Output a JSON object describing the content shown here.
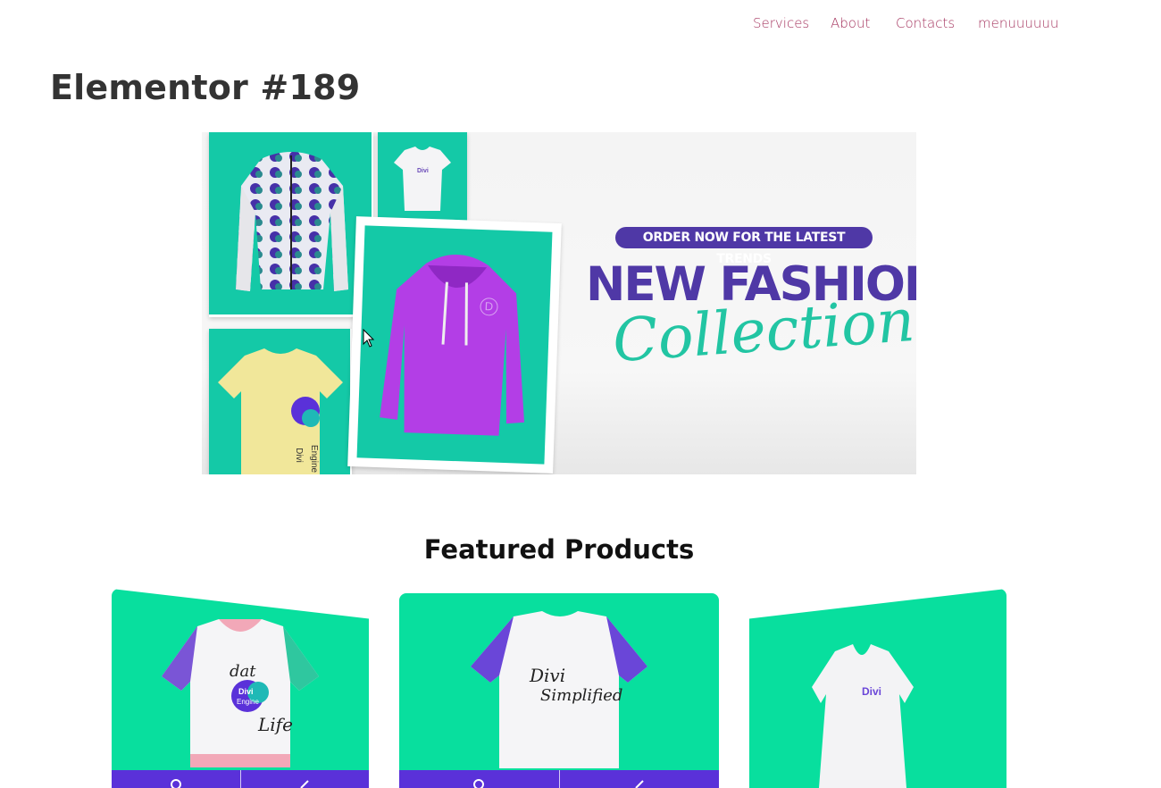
{
  "nav": {
    "items": [
      "Services",
      "About",
      "Contacts",
      "menuuuuuu"
    ]
  },
  "page": {
    "title": "Elementor #189"
  },
  "banner": {
    "pill_text": "ORDER NOW FOR THE LATEST TRENDS",
    "headline": "NEW FASHION",
    "script_text": "Collection",
    "hoodie_logo": "D",
    "tshirt_print": [
      "Divi",
      "Engine"
    ],
    "tee_print": "Divi",
    "colors": {
      "accent_purple": "#4f38a6",
      "accent_teal": "#14c9a7",
      "hoodie": "#b33ee6"
    }
  },
  "featured": {
    "heading": "Featured Products",
    "products": [
      {
        "print_lines": [
          "dat",
          "Divi",
          "Engine",
          "Life"
        ],
        "actions": [
          "view-icon",
          "link-icon"
        ]
      },
      {
        "print_lines": [
          "Divi",
          "Simplified"
        ],
        "actions": [
          "view-icon",
          "link-icon"
        ]
      },
      {
        "print_lines": [
          "Divi"
        ],
        "actions": []
      }
    ],
    "colors": {
      "card_bg": "#08df9e",
      "action_bar": "#5a31d9"
    }
  }
}
